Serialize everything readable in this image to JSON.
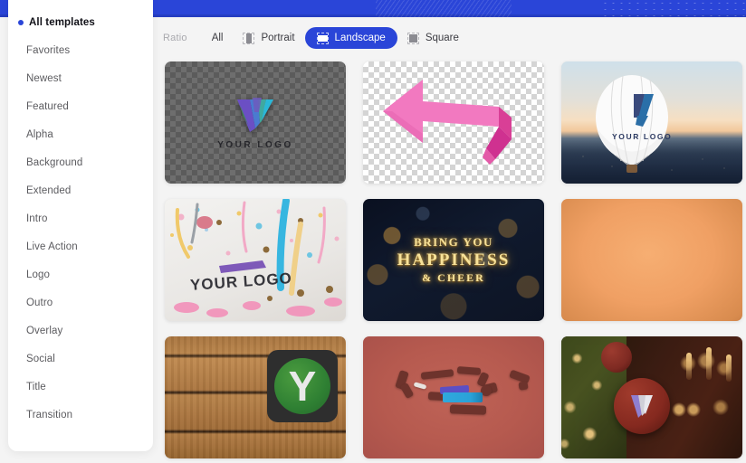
{
  "header": {
    "accent_color": "#2a45d8",
    "pattern_left": "diagonal-stripes",
    "pattern_right": "dot-grid"
  },
  "sidebar": {
    "items": [
      {
        "label": "All templates",
        "active": true
      },
      {
        "label": "Favorites",
        "active": false
      },
      {
        "label": "Newest",
        "active": false
      },
      {
        "label": "Featured",
        "active": false
      },
      {
        "label": "Alpha",
        "active": false
      },
      {
        "label": "Background",
        "active": false
      },
      {
        "label": "Extended",
        "active": false
      },
      {
        "label": "Intro",
        "active": false
      },
      {
        "label": "Live Action",
        "active": false
      },
      {
        "label": "Logo",
        "active": false
      },
      {
        "label": "Outro",
        "active": false
      },
      {
        "label": "Overlay",
        "active": false
      },
      {
        "label": "Social",
        "active": false
      },
      {
        "label": "Title",
        "active": false
      },
      {
        "label": "Transition",
        "active": false
      }
    ]
  },
  "ratio_filter": {
    "label": "Ratio",
    "selected": "Landscape",
    "options": [
      {
        "label": "All",
        "icon": "none",
        "active": false
      },
      {
        "label": "Portrait",
        "icon": "portrait-frame-icon",
        "active": false
      },
      {
        "label": "Landscape",
        "icon": "landscape-frame-icon",
        "active": true
      },
      {
        "label": "Square",
        "icon": "square-frame-icon",
        "active": false
      }
    ]
  },
  "grid": {
    "cards": [
      {
        "id": "card-alpha-logo",
        "caption": "YOUR LOGO",
        "style": "dark-checker-transparency"
      },
      {
        "id": "card-pink-arrow",
        "caption": "",
        "style": "light-checker-transparency"
      },
      {
        "id": "card-hot-air-balloon",
        "caption": "YOUR LOGO",
        "style": "sunset-cityscape-photo"
      },
      {
        "id": "card-confetti",
        "caption": "YOUR LOGO",
        "style": "confetti-streamers-photo"
      },
      {
        "id": "card-happiness",
        "caption": "",
        "style": "gold-bokeh-title",
        "title_line1": "BRING YOU",
        "title_line2": "HAPPINESS",
        "title_line3": "& CHEER"
      },
      {
        "id": "card-orange-gradient",
        "caption": "",
        "style": "orange-radial-gradient"
      },
      {
        "id": "card-wood-badge",
        "caption": "Y",
        "style": "wood-plank-photo"
      },
      {
        "id": "card-red-sticks",
        "caption": "",
        "style": "red-object-scatter"
      },
      {
        "id": "card-christmas",
        "caption": "V",
        "style": "christmas-ornament-photo"
      }
    ]
  }
}
